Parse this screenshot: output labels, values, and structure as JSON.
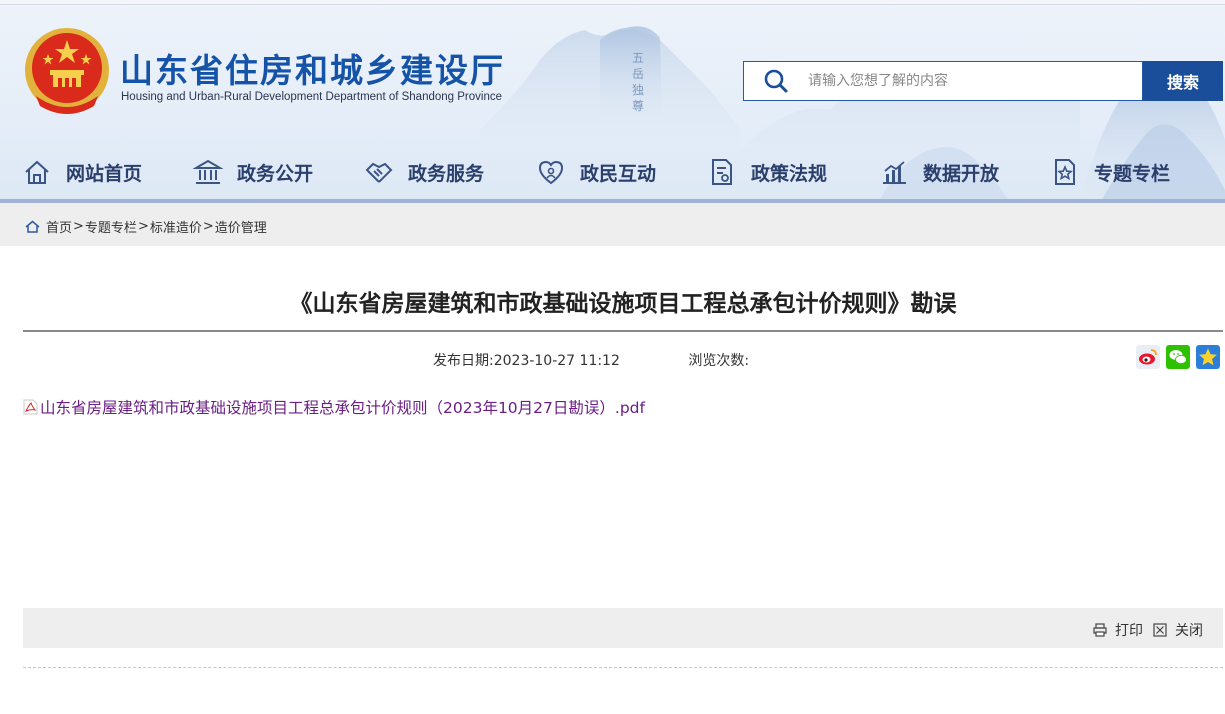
{
  "header": {
    "title": "山东省住房和城乡建设厅",
    "subtitle": "Housing and Urban-Rural Development Department of Shandong Province",
    "emblem_icon": "national-emblem-icon"
  },
  "search": {
    "placeholder": "请输入您想了解的内容",
    "button_label": "搜索"
  },
  "nav": {
    "items": [
      {
        "label": "网站首页",
        "icon": "home-icon"
      },
      {
        "label": "政务公开",
        "icon": "building-icon"
      },
      {
        "label": "政务服务",
        "icon": "handshake-icon"
      },
      {
        "label": "政民互动",
        "icon": "heart-people-icon"
      },
      {
        "label": "政策法规",
        "icon": "document-icon"
      },
      {
        "label": "数据开放",
        "icon": "chart-icon"
      },
      {
        "label": "专题专栏",
        "icon": "star-file-icon"
      }
    ]
  },
  "breadcrumb": {
    "items": [
      "首页",
      "专题专栏",
      "标准造价",
      "造价管理"
    ],
    "separator": ">"
  },
  "article": {
    "title": "《山东省房屋建筑和市政基础设施项目工程总承包计价规则》勘误",
    "publish_label": "发布日期:",
    "publish_date": "2023-10-27 11:12",
    "views_label": "浏览次数:",
    "attachment": "山东省房屋建筑和市政基础设施项目工程总承包计价规则（2023年10月27日勘误）.pdf"
  },
  "share": [
    "weibo-icon",
    "wechat-icon",
    "qzone-icon"
  ],
  "tools": {
    "print_label": "打印",
    "close_label": "关闭"
  },
  "colors": {
    "brand_blue": "#1553a8",
    "nav_text": "#2a3f6b",
    "search_button": "#1a4e9a",
    "link_purple": "#6b1e86"
  }
}
